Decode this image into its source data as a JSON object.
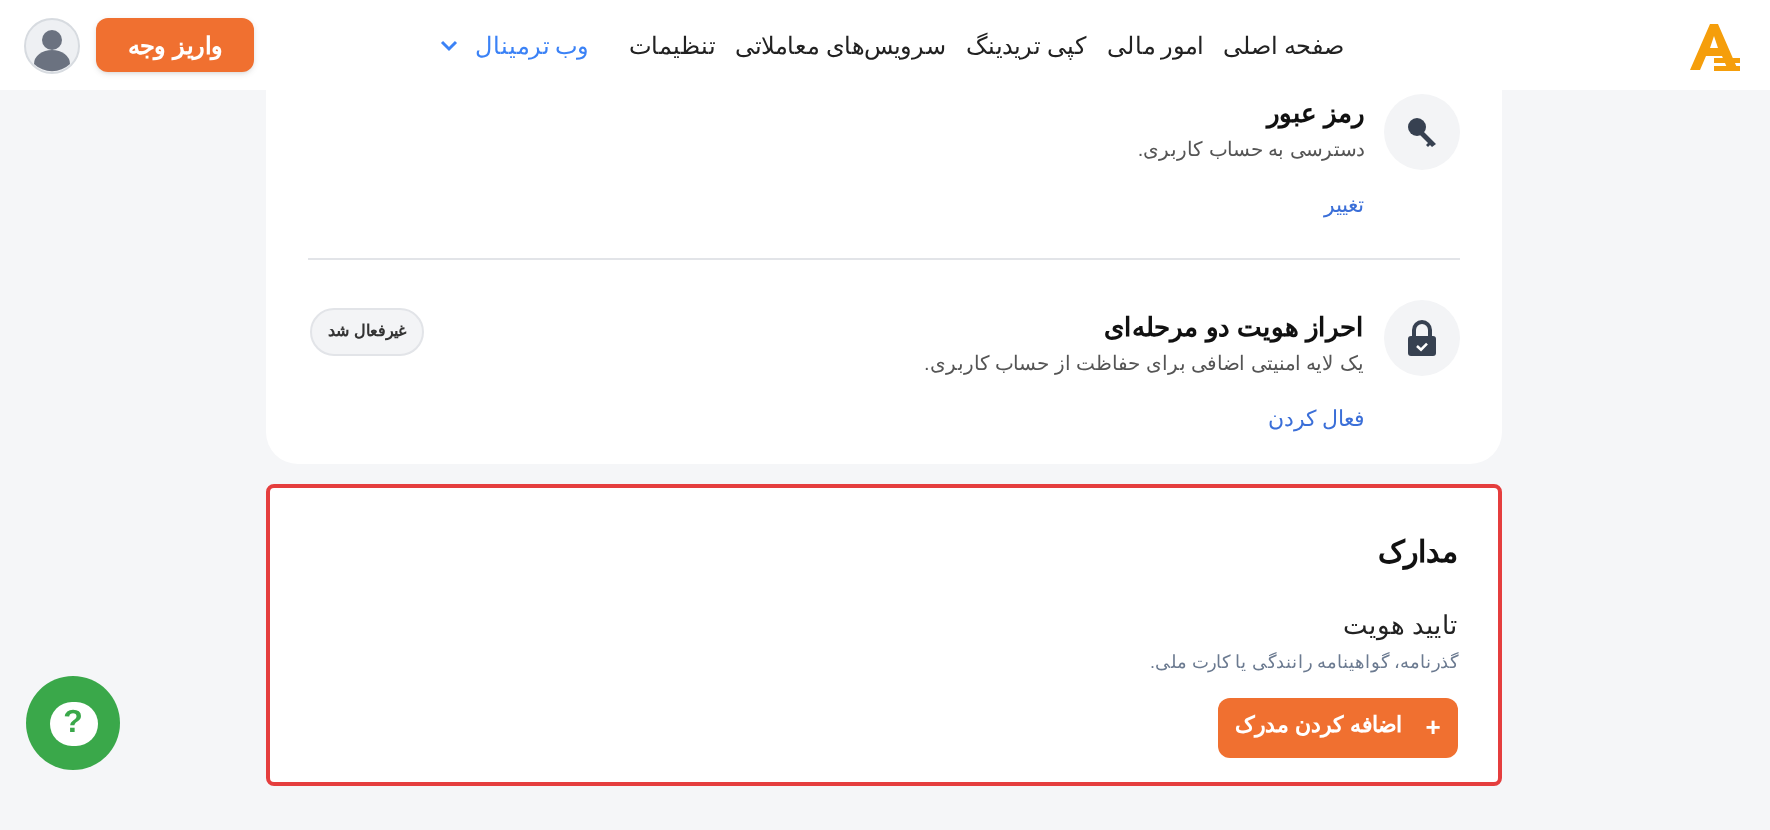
{
  "header": {
    "nav": [
      {
        "label": "صفحه اصلی",
        "kind": "plain"
      },
      {
        "label": "امور مالی",
        "kind": "plain"
      },
      {
        "label": "کپی تریدینگ",
        "kind": "plain"
      },
      {
        "label": "سرویس‌های معاملاتی",
        "kind": "plain"
      },
      {
        "label": "تنظیمات",
        "kind": "plain"
      },
      {
        "label": "وب ترمینال",
        "kind": "dropdown"
      }
    ],
    "deposit_button": "واریز وجه"
  },
  "security": {
    "items": [
      {
        "kind": "key",
        "title": "رمز عبور",
        "description": "دسترسی به حساب کاربری.",
        "action": "تغییر"
      },
      {
        "kind": "lock",
        "title": "احراز هویت دو مرحله‌ای",
        "description": "یک لایه امنیتی اضافی برای حفاظت از حساب کاربری.",
        "action": "فعال کردن",
        "badge": "غیرفعال شد"
      }
    ]
  },
  "documents": {
    "title": "مدارک",
    "subtitle": "تایید هویت",
    "description": "گذرنامه، گواهینامه رانندگی یا کارت ملی.",
    "button_icon": "+",
    "button": "اضافه کردن مدرک"
  },
  "help_button": "?"
}
